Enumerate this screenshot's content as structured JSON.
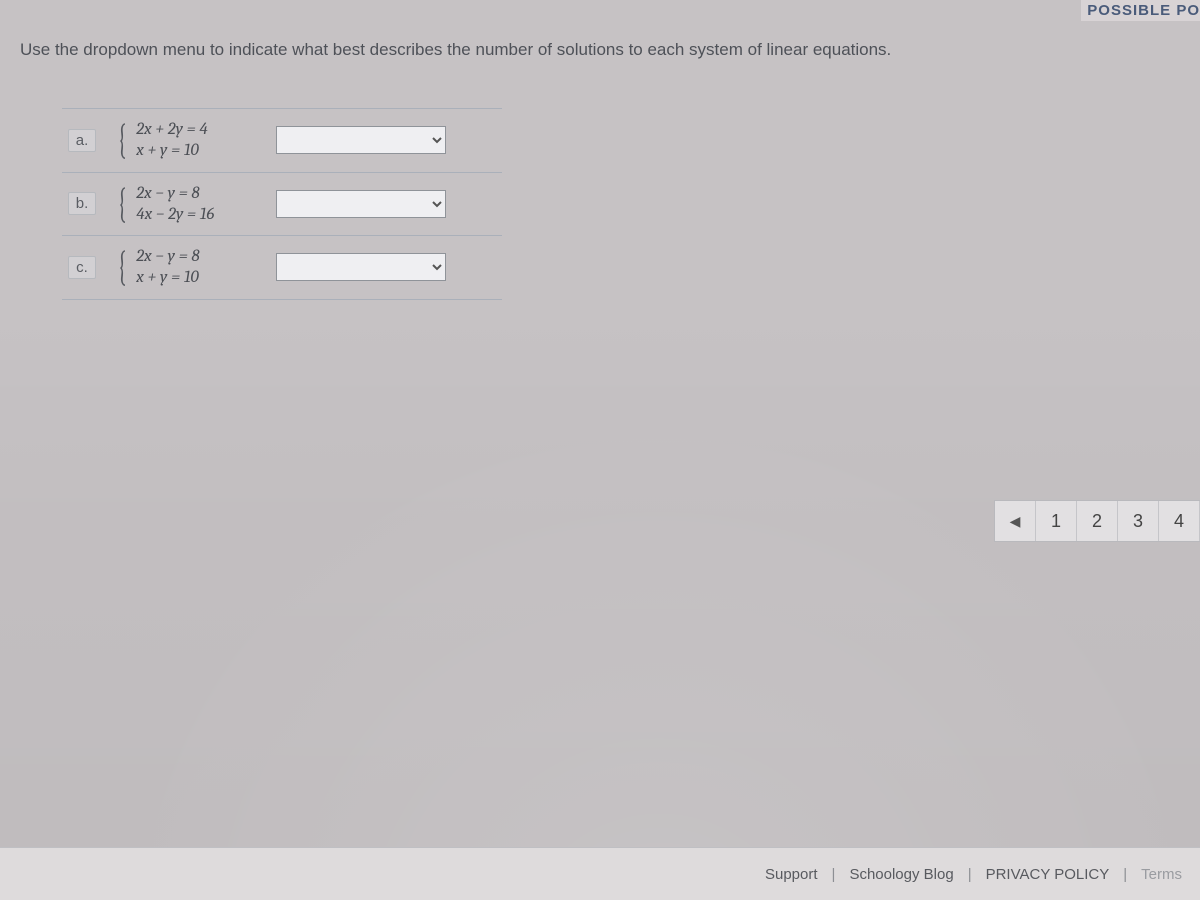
{
  "header_fragment": "POSSIBLE PO",
  "prompt": "Use the dropdown menu to indicate what best describes the number of solutions to each system of linear equations.",
  "items": [
    {
      "letter": "a.",
      "eq1": "2x + 2y = 4",
      "eq2": "x + y = 10",
      "selected": ""
    },
    {
      "letter": "b.",
      "eq1": "2x − y = 8",
      "eq2": "4x − 2y = 16",
      "selected": ""
    },
    {
      "letter": "c.",
      "eq1": "2x − y = 8",
      "eq2": "x + y = 10",
      "selected": ""
    }
  ],
  "pager": {
    "prev": "◀",
    "pages": [
      "1",
      "2",
      "3",
      "4"
    ]
  },
  "footer": {
    "support": "Support",
    "blog": "Schoology Blog",
    "privacy": "PRIVACY POLICY",
    "terms": "Terms",
    "sep": "|"
  }
}
